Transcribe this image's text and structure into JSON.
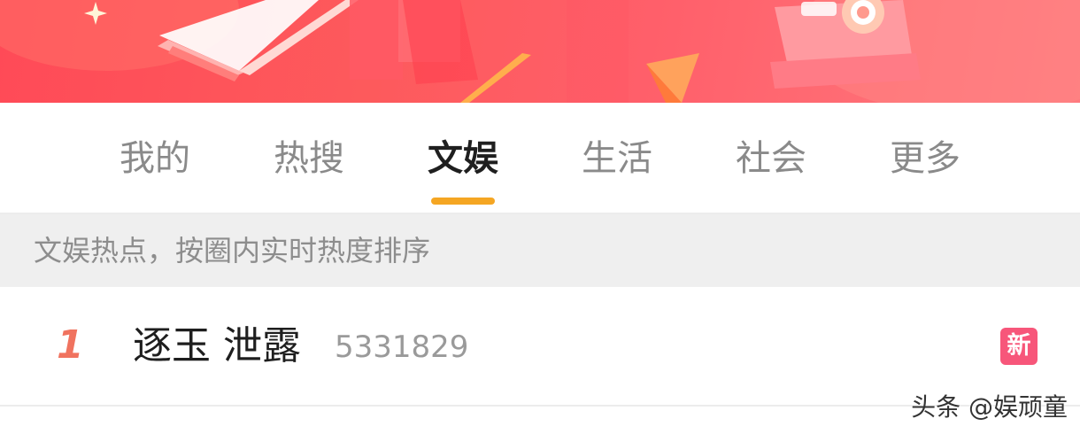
{
  "tabs": [
    {
      "label": "我的"
    },
    {
      "label": "热搜"
    },
    {
      "label": "文娱"
    },
    {
      "label": "生活"
    },
    {
      "label": "社会"
    },
    {
      "label": "更多"
    }
  ],
  "active_tab": "文娱",
  "info": "文娱热点，按圈内实时热度排序",
  "list": [
    {
      "rank": "1",
      "title": "逐玉 泄露",
      "count": "5331829",
      "badge": "新"
    }
  ],
  "watermark": "头条 @娱顽童",
  "colors": {
    "banner": "#ff4a57",
    "accent_indicator": "#f5a623",
    "rank": "#f0735f",
    "badge": "#f7567a"
  },
  "icons": [
    "book-icon",
    "camera-icon",
    "sparkle-icon",
    "triangle-icon"
  ]
}
